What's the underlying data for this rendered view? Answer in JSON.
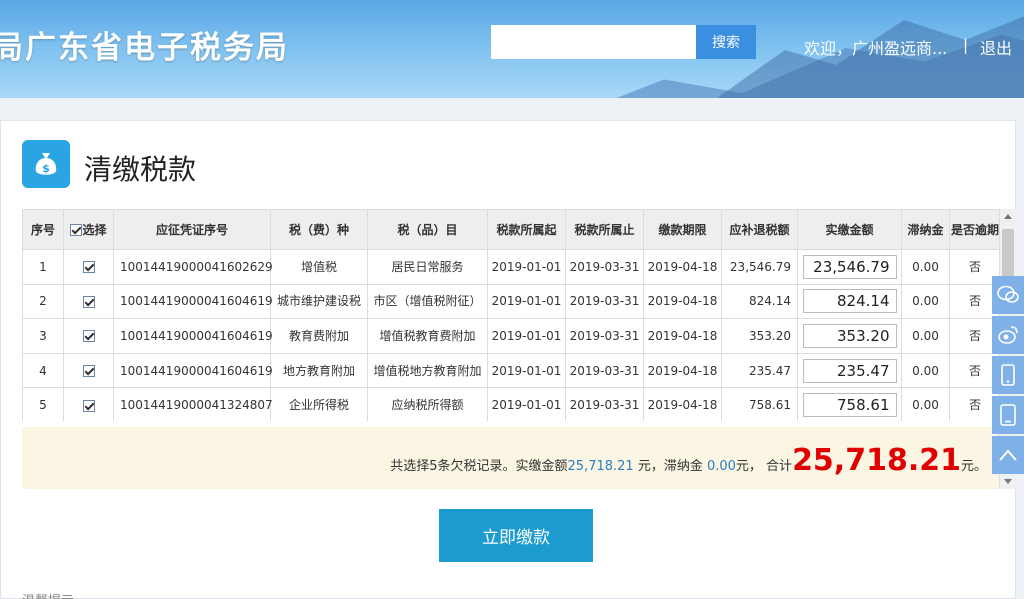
{
  "header": {
    "title": "局广东省电子税务局",
    "search_placeholder": "",
    "search_button": "搜索",
    "welcome": "欢迎，广州盈远商...",
    "separator": "|",
    "logout": "退出"
  },
  "page": {
    "icon": "money-bag-icon",
    "title": "清缴税款"
  },
  "table": {
    "columns": [
      "序号",
      "选择",
      "应征凭证序号",
      "税（费）种",
      "税（品）目",
      "税款所属起",
      "税款所属止",
      "缴款期限",
      "应补退税额",
      "实缴金额",
      "滞纳金",
      "是否逾期"
    ],
    "rows": [
      {
        "seq": "1",
        "voucher": "10014419000041602629",
        "tax_type": "增值税",
        "tax_item": "居民日常服务",
        "start": "2019-01-01",
        "end": "2019-03-31",
        "deadline": "2019-04-18",
        "due": "23,546.79",
        "paid": "23,546.79",
        "late_fee": "0.00",
        "overdue": "否"
      },
      {
        "seq": "2",
        "voucher": "10014419000041604619",
        "tax_type": "城市维护建设税",
        "tax_item": "市区（增值税附征）",
        "start": "2019-01-01",
        "end": "2019-03-31",
        "deadline": "2019-04-18",
        "due": "824.14",
        "paid": "824.14",
        "late_fee": "0.00",
        "overdue": "否"
      },
      {
        "seq": "3",
        "voucher": "10014419000041604619",
        "tax_type": "教育费附加",
        "tax_item": "增值税教育费附加",
        "start": "2019-01-01",
        "end": "2019-03-31",
        "deadline": "2019-04-18",
        "due": "353.20",
        "paid": "353.20",
        "late_fee": "0.00",
        "overdue": "否"
      },
      {
        "seq": "4",
        "voucher": "10014419000041604619",
        "tax_type": "地方教育附加",
        "tax_item": "增值税地方教育附加",
        "start": "2019-01-01",
        "end": "2019-03-31",
        "deadline": "2019-04-18",
        "due": "235.47",
        "paid": "235.47",
        "late_fee": "0.00",
        "overdue": "否"
      },
      {
        "seq": "5",
        "voucher": "10014419000041324807",
        "tax_type": "企业所得税",
        "tax_item": "应纳税所得额",
        "start": "2019-01-01",
        "end": "2019-03-31",
        "deadline": "2019-04-18",
        "due": "758.61",
        "paid": "758.61",
        "late_fee": "0.00",
        "overdue": "否"
      }
    ]
  },
  "summary": {
    "prefix": "共选择5条欠税记录。实缴金额",
    "paid_amount": "25,718.21",
    "mid1": "元，滞纳金 ",
    "late_amount": "0.00",
    "mid2": "元， 合计",
    "total": "25,718.21",
    "suffix": "元。"
  },
  "pay_button": "立即缴款",
  "hint": "温馨提示",
  "float_bar": [
    "wechat-icon",
    "weibo-icon",
    "mobile-icon",
    "tablet-icon",
    "back-to-top-icon"
  ],
  "colors": {
    "accent": "#1b9bd0",
    "total_red": "#e00000",
    "link_blue": "#2b7cc2"
  }
}
